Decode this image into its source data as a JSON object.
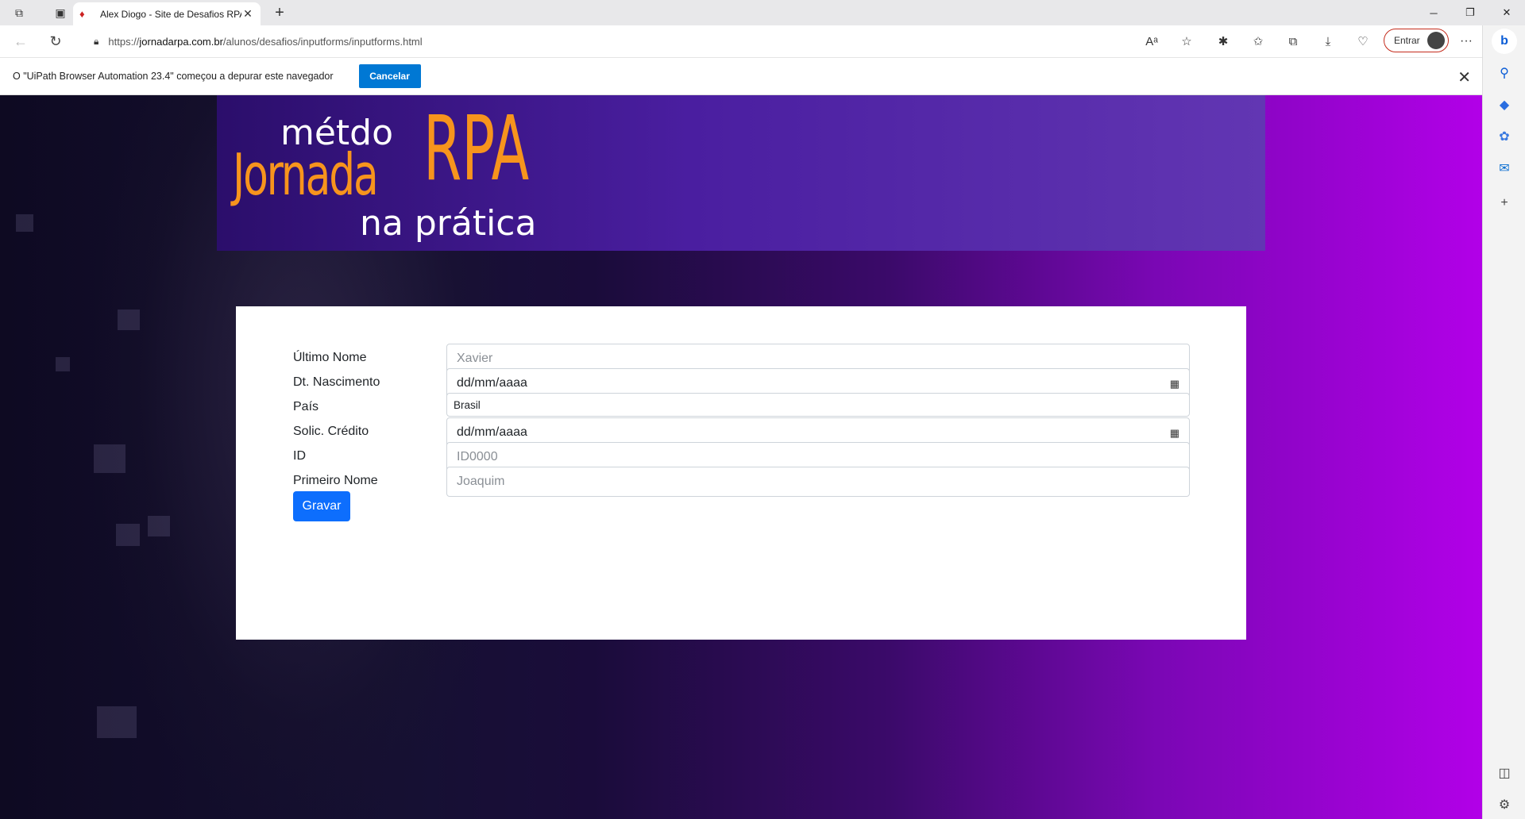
{
  "browser": {
    "tab_title": "Alex Diogo - Site de Desafios RPA",
    "url_prefix": "https://",
    "url_host": "jornadarpa.com.br",
    "url_path": "/alunos/desafios/inputforms/inputforms.html",
    "signin_label": "Entrar"
  },
  "infobar": {
    "message": "O \"UiPath Browser Automation 23.4\" começou a depurar este navegador",
    "cancel_label": "Cancelar"
  },
  "logo": {
    "line1": "métdo",
    "line2": "Jornada",
    "line2b": "RPA",
    "line3": "na prática"
  },
  "form": {
    "rows": [
      {
        "label": "Último Nome",
        "value": "Xavier",
        "placeholder": true
      },
      {
        "label": "Dt. Nascimento",
        "value": "dd/mm/aaaa",
        "placeholder": false
      },
      {
        "label": "País",
        "value": "Brasil",
        "placeholder": false
      },
      {
        "label": "Solic. Crédito",
        "value": "dd/mm/aaaa",
        "placeholder": false
      },
      {
        "label": "ID",
        "value": "ID0000",
        "placeholder": true
      },
      {
        "label": "Primeiro Nome",
        "value": "Joaquim",
        "placeholder": true
      }
    ],
    "submit_label": "Gravar"
  },
  "colors": {
    "accent": "#0d6efd",
    "logo_orange": "#f7941d",
    "infobar_button": "#0078d4"
  }
}
